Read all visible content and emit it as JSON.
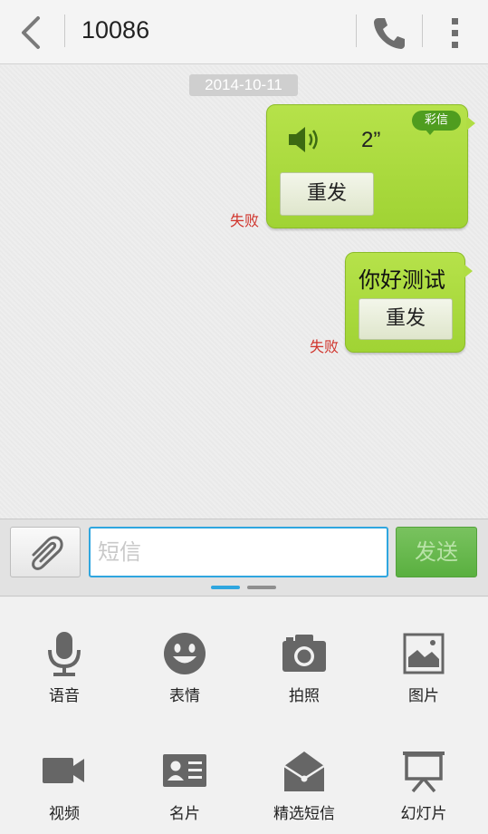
{
  "header": {
    "title": "10086"
  },
  "chat": {
    "date": "2014-10-11",
    "messages": [
      {
        "badge": "彩信",
        "duration": "2”",
        "resend_label": "重发",
        "status": "失败"
      },
      {
        "text": "你好测试",
        "resend_label": "重发",
        "status": "失败"
      }
    ]
  },
  "composer": {
    "placeholder": "短信",
    "send_label": "发送"
  },
  "panel": {
    "items": [
      {
        "label": "语音",
        "icon": "microphone-icon"
      },
      {
        "label": "表情",
        "icon": "smiley-icon"
      },
      {
        "label": "拍照",
        "icon": "camera-icon"
      },
      {
        "label": "图片",
        "icon": "picture-icon"
      },
      {
        "label": "视频",
        "icon": "video-camera-icon"
      },
      {
        "label": "名片",
        "icon": "contact-card-icon"
      },
      {
        "label": "精选短信",
        "icon": "envelope-icon"
      },
      {
        "label": "幻灯片",
        "icon": "slideshow-icon"
      }
    ]
  },
  "colors": {
    "accent": "#2fa6df",
    "bubble": "#a8d83c",
    "failed": "#d0342c",
    "send": "#5ab040"
  }
}
